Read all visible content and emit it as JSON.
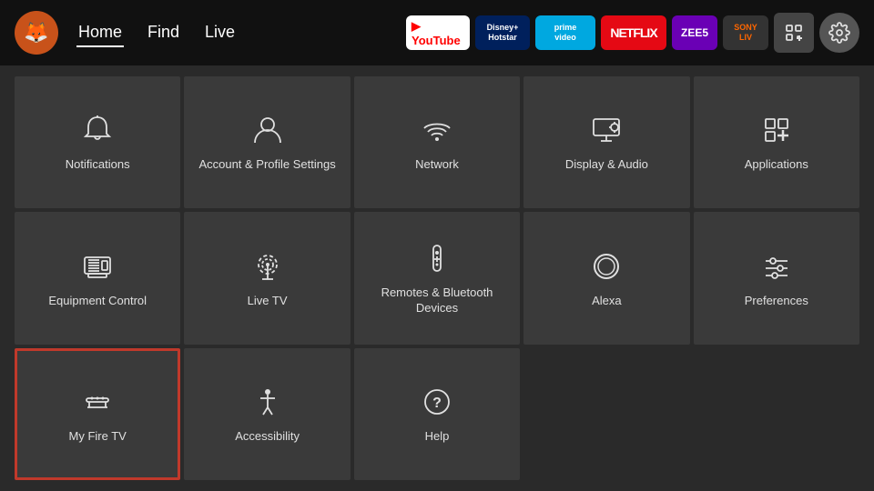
{
  "nav": {
    "logo": "🦊",
    "links": [
      {
        "label": "Home",
        "active": true
      },
      {
        "label": "Find",
        "active": false
      },
      {
        "label": "Live",
        "active": false
      }
    ],
    "apps": [
      {
        "id": "youtube",
        "label": "▶ YouTube",
        "class": "yt-icon"
      },
      {
        "id": "disney",
        "label": "Disney+\nHotstar",
        "class": "disney-icon"
      },
      {
        "id": "prime",
        "label": "prime video",
        "class": "prime-icon"
      },
      {
        "id": "netflix",
        "label": "NETFLIX",
        "class": "netflix-icon"
      },
      {
        "id": "zee5",
        "label": "ZEE5",
        "class": "zee5-icon"
      },
      {
        "id": "sony",
        "label": "SONY\nLIV",
        "class": "sony-icon"
      }
    ]
  },
  "tiles": [
    {
      "id": "notifications",
      "label": "Notifications",
      "icon": "bell",
      "selected": false,
      "row": 1,
      "col": 1
    },
    {
      "id": "account-profile",
      "label": "Account & Profile Settings",
      "icon": "person",
      "selected": false,
      "row": 1,
      "col": 2
    },
    {
      "id": "network",
      "label": "Network",
      "icon": "wifi",
      "selected": false,
      "row": 1,
      "col": 3
    },
    {
      "id": "display-audio",
      "label": "Display & Audio",
      "icon": "display",
      "selected": false,
      "row": 1,
      "col": 4
    },
    {
      "id": "applications",
      "label": "Applications",
      "icon": "apps",
      "selected": false,
      "row": 1,
      "col": 5
    },
    {
      "id": "equipment-control",
      "label": "Equipment Control",
      "icon": "tv",
      "selected": false,
      "row": 2,
      "col": 1
    },
    {
      "id": "live-tv",
      "label": "Live TV",
      "icon": "antenna",
      "selected": false,
      "row": 2,
      "col": 2
    },
    {
      "id": "remotes-bluetooth",
      "label": "Remotes & Bluetooth Devices",
      "icon": "remote",
      "selected": false,
      "row": 2,
      "col": 3
    },
    {
      "id": "alexa",
      "label": "Alexa",
      "icon": "alexa",
      "selected": false,
      "row": 2,
      "col": 4
    },
    {
      "id": "preferences",
      "label": "Preferences",
      "icon": "sliders",
      "selected": false,
      "row": 2,
      "col": 5
    },
    {
      "id": "my-fire-tv",
      "label": "My Fire TV",
      "icon": "firetv",
      "selected": true,
      "row": 3,
      "col": 1
    },
    {
      "id": "accessibility",
      "label": "Accessibility",
      "icon": "accessibility",
      "selected": false,
      "row": 3,
      "col": 2
    },
    {
      "id": "help",
      "label": "Help",
      "icon": "help",
      "selected": false,
      "row": 3,
      "col": 3
    }
  ]
}
